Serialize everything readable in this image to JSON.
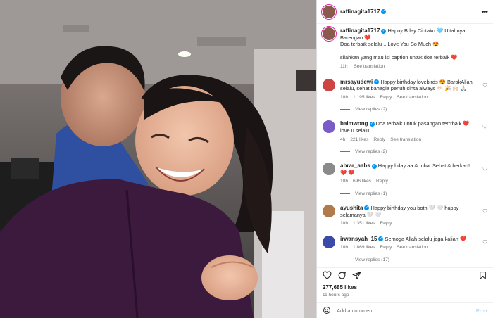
{
  "post": {
    "username": "raffinagita1717",
    "more_icon": "more-horizontal-icon",
    "likes": "277,685 likes",
    "time_ago": "11 hours ago",
    "add_comment_placeholder": "Add a comment...",
    "post_label": "Post"
  },
  "caption": {
    "username": "raffinagita1717",
    "text1": "Hapoy Bday Cintaku 🩵 Ultahnya Barengan ❤️",
    "text2": "Doa terbaik selalu .. Love You So Much 😍",
    "text3": "silahkan yang mau isi caption untuk doa terbaik ❤️",
    "time": "11h",
    "see_translation": "See translation"
  },
  "comments": [
    {
      "username": "mrsayudewi",
      "verified": true,
      "text": "Happy birthday lovebirds 😍 BarakAllah selalu, sehat bahagia penuh cinta always 🫶🏻 🎉 🙌🏻 🙏🏻",
      "time": "10h",
      "likes": "1,195 likes",
      "reply": "Reply",
      "translate": "See translation",
      "view_replies": "View replies (2)",
      "avatar_color": "#c44"
    },
    {
      "username": "baimwong",
      "verified": true,
      "text": "Doa terbaik untuk pasangan terrrbaik ❤️ love u selalu",
      "time": "4h",
      "likes": "221 likes",
      "reply": "Reply",
      "translate": "See translation",
      "view_replies": "View replies (2)",
      "avatar_color": "#7a5cc9"
    },
    {
      "username": "abrar_aabs",
      "verified": true,
      "text": "Happy bday aa & mba. Sehat & berkah! ❤️ ❤️",
      "time": "10h",
      "likes": "696 likes",
      "reply": "Reply",
      "translate": "",
      "view_replies": "View replies (1)",
      "avatar_color": "#8a8a8a"
    },
    {
      "username": "ayushita",
      "verified": true,
      "text": "Happy birthday you both 🤍 🤍 happy selamanya 🤍 🤍",
      "time": "10h",
      "likes": "1,351 likes",
      "reply": "Reply",
      "translate": "",
      "view_replies": "",
      "avatar_color": "#b07a4a"
    },
    {
      "username": "irwansyah_15",
      "verified": true,
      "text": "Semoga Allah selalu jaga kalian ❤️",
      "time": "10h",
      "likes": "1,869 likes",
      "reply": "Reply",
      "translate": "See translation",
      "view_replies": "View replies (17)",
      "avatar_color": "#3b4aa8"
    }
  ],
  "colors": {
    "verified": "#0095f6",
    "heart_red": "#ed4956",
    "post_disabled": "#b2dffc"
  }
}
